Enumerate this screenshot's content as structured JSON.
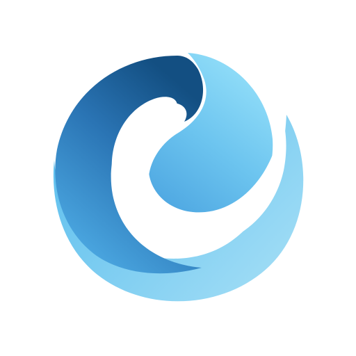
{
  "logo": {
    "icon": "blue-swirl-circle-logo",
    "colors": {
      "background": "#ffffff",
      "light_blue": "#aee3f7",
      "mid_blue": "#6cc6ee",
      "sky_blue": "#4aa8e2",
      "dark_blue": "#16578c",
      "white": "#ffffff"
    }
  }
}
